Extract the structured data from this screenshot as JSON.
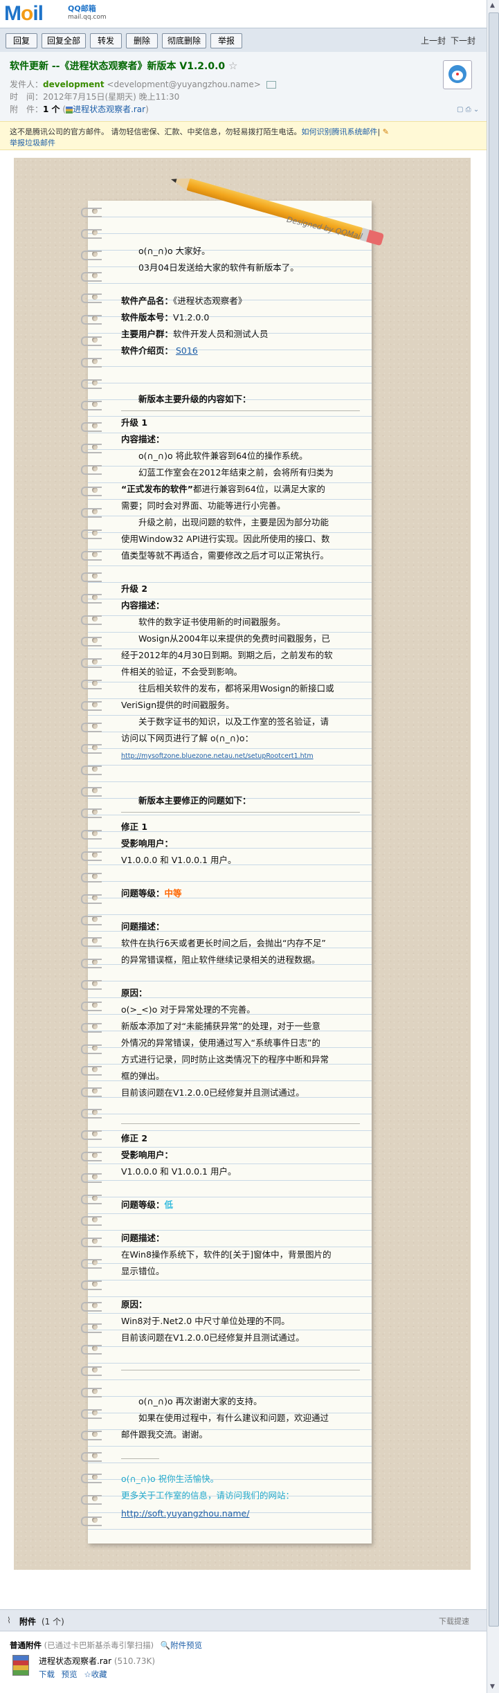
{
  "brand": {
    "logo_text": "Mail",
    "qq_text": "QQ邮箱",
    "qq_sub": "mail.qq.com"
  },
  "toolbar": {
    "buttons": [
      "回复",
      "回复全部",
      "转发",
      "删除",
      "彻底删除",
      "举报"
    ],
    "prev": "上一封",
    "next": "下一封"
  },
  "header": {
    "subject": "软件更新 --《进程状态观察者》新版本 V1.2.0.0",
    "star": "☆",
    "from_label": "发件人：",
    "from_name": "development",
    "from_email": "<development@yuyangzhou.name>",
    "time_label": "时　间：",
    "time_value": "2012年7月15日(星期天) 晚上11:30",
    "attach_label": "附　件：",
    "attach_count": "1 个",
    "attach_name": "进程状态观察者.rar"
  },
  "warning": {
    "text": "这不是腾讯公司的官方邮件。 请勿轻信密保、汇款、中奖信息，勿轻易拨打陌生电话。",
    "link1": "如何识别腾讯系统邮件",
    "link2": "举报垃圾邮件"
  },
  "letter": {
    "designed": "Designed by QQMail",
    "greeting": "o(∩_∩)o  大家好。",
    "intro": "03月04日发送给大家的软件有新版本了。",
    "product_label": "软件产品名：",
    "product_value": "《进程状态观察者》",
    "version_label": "软件版本号：",
    "version_value": "V1.2.0.0",
    "users_label": "主要用户群：",
    "users_value": "软件开发人员和测试人员",
    "page_label": "软件介绍页：",
    "page_value": "S016",
    "upgrades_heading": "新版本主要升级的内容如下：",
    "upgrade1_title": "升级 1",
    "desc_label": "内容描述：",
    "u1_p1": "o(∩_∩)o  将此软件兼容到64位的操作系统。",
    "u1_p2a": "幻蓝工作室会在2012年结束之前，会将所有归类为",
    "u1_p2b_bold": "“正式发布的软件”",
    "u1_p2b_rest": "都进行兼容到64位，以满足大家的",
    "u1_p2c": "需要；同时会对界面、功能等进行小完善。",
    "u1_p3a": "升级之前，出现问题的软件，主要是因为部分功能",
    "u1_p3b": "使用Window32 API进行实现。因此所使用的接口、数",
    "u1_p3c": "值类型等就不再适合，需要修改之后才可以正常执行。",
    "upgrade2_title": "升级 2",
    "u2_p1": "软件的数字证书使用新的时间戳服务。",
    "u2_p2a": "Wosign从2004年以来提供的免费时间戳服务，已",
    "u2_p2b": "经于2012年的4月30日到期。到期之后，之前发布的软",
    "u2_p2c": "件相关的验证，不会受到影响。",
    "u2_p3a": "往后相关软件的发布，都将采用Wosign的新接口或",
    "u2_p3b": "VeriSign提供的时间戳服务。",
    "u2_p4a": "关于数字证书的知识，以及工作室的签名验证，请",
    "u2_p4b": "访问以下网页进行了解  o(∩_∩)o：",
    "u2_url": "http://mysoftzone.bluezone.netau.net/setupRootcert1.htm",
    "fixes_heading": "新版本主要修正的问题如下：",
    "fix1_title": "修正 1",
    "affected_label": "受影响用户：",
    "affected_value": "V1.0.0.0 和  V1.0.0.1  用户。",
    "level_label": "问题等级：",
    "fix1_level": "中等",
    "problem_label": "问题描述：",
    "f1_prob_a": "软件在执行6天或者更长时间之后，会抛出“内存不足”",
    "f1_prob_b": "的异常错误框，阻止软件继续记录相关的进程数据。",
    "cause_label": "原因：",
    "f1_cause_a": "o(>_<)o  对于异常处理的不完善。",
    "f1_cause_b": "新版本添加了对“未能捕获异常”的处理，对于一些意",
    "f1_cause_c": "外情况的异常错误，使用通过写入“系统事件日志”的",
    "f1_cause_d": "方式进行记录，同时防止这类情况下的程序中断和异常",
    "f1_cause_e": "框的弹出。",
    "fixed_note": "目前该问题在V1.2.0.0已经修复并且测试通过。",
    "fix2_title": "修正 2",
    "fix2_level": "低",
    "f2_prob_a": "在Win8操作系统下，软件的[关于]窗体中，背景图片的",
    "f2_prob_b": "显示错位。",
    "f2_cause_a": "Win8对于.Net2.0 中尺寸单位处理的不同。",
    "thanks": "o(∩_∩)o 再次谢谢大家的支持。",
    "feedback_a": "如果在使用过程中，有什么建议和问题，欢迎通过",
    "feedback_b": "邮件跟我交流。谢谢。",
    "wish": "o(∩_∩)o  祝你生活愉快。",
    "more_info": "更多关于工作室的信息，请访问我们的网站：",
    "site_url": "http://soft.yuyangzhou.name/"
  },
  "attachments": {
    "title": "附件",
    "count": "(1 个)",
    "download_tip": "下载提速",
    "section": "普通附件",
    "scan": "(已通过卡巴斯基杀毒引擎扫描)",
    "preview_link": "附件预览",
    "file_name": "进程状态观察者.rar",
    "file_size": "(510.73K)",
    "actions": [
      "下载",
      "预览",
      "收藏"
    ]
  },
  "colors": {
    "subject": "#006600",
    "accent_link": "#1e5fa8",
    "medium": "#ff6600",
    "low": "#33bbdd",
    "signature": "#22a9cc"
  }
}
